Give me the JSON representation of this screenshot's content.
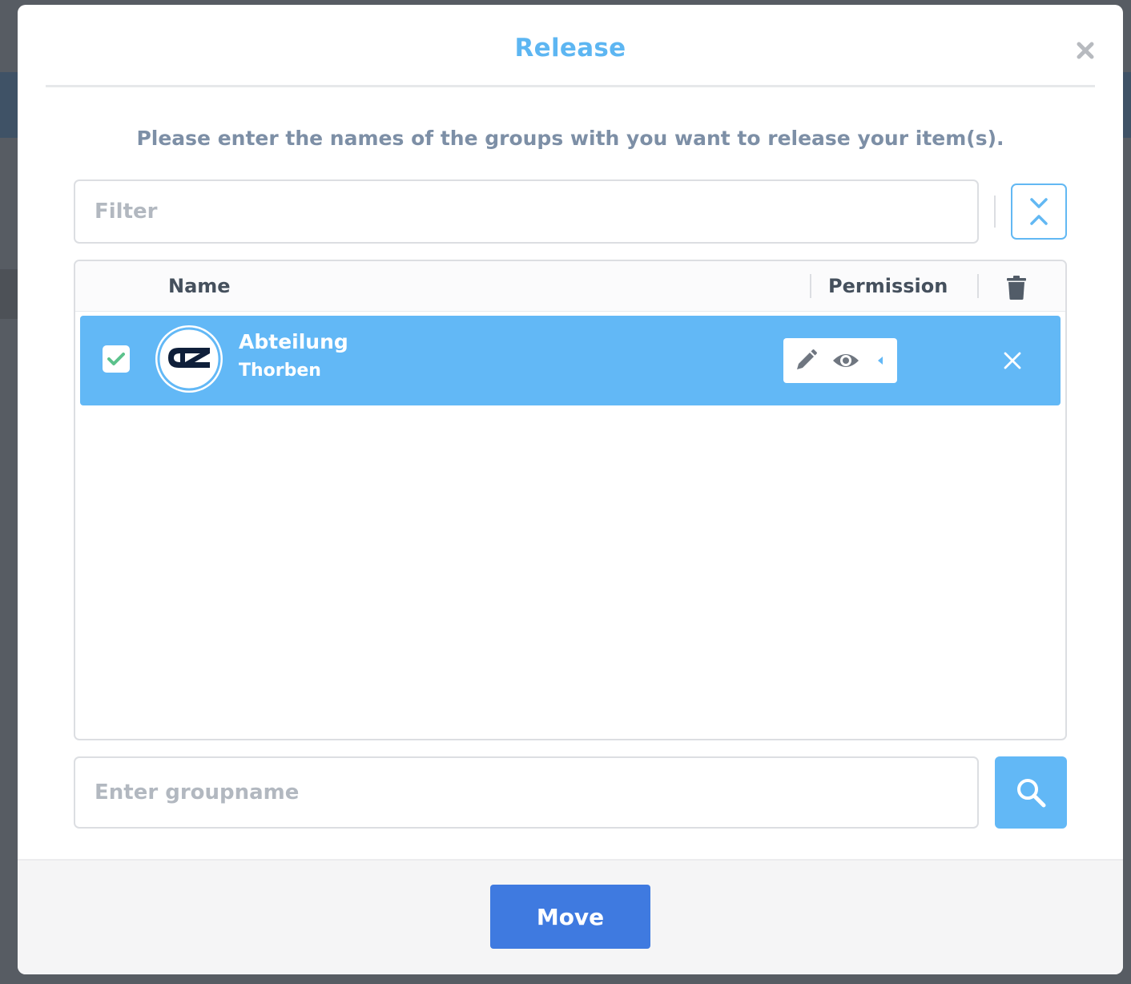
{
  "modal": {
    "title": "Release",
    "prompt": "Please enter the names of the groups with you want to release your item(s).",
    "filter_placeholder": "Filter",
    "groupname_placeholder": "Enter groupname",
    "move_label": "Move"
  },
  "table": {
    "columns": {
      "name": "Name",
      "permission": "Permission"
    },
    "rows": [
      {
        "title": "Abteilung",
        "subtitle": "Thorben",
        "checked": true,
        "avatar": "az-logo"
      }
    ]
  },
  "icons": [
    "close-icon",
    "expand-collapse-icon",
    "trash-icon",
    "check-icon",
    "pencil-icon",
    "eye-icon",
    "caret-left-icon",
    "x-icon",
    "search-icon"
  ],
  "colors": {
    "accent": "#62b8f6",
    "title": "#5db6f2",
    "primary_button": "#3f7ae0",
    "check": "#5cc28c"
  }
}
